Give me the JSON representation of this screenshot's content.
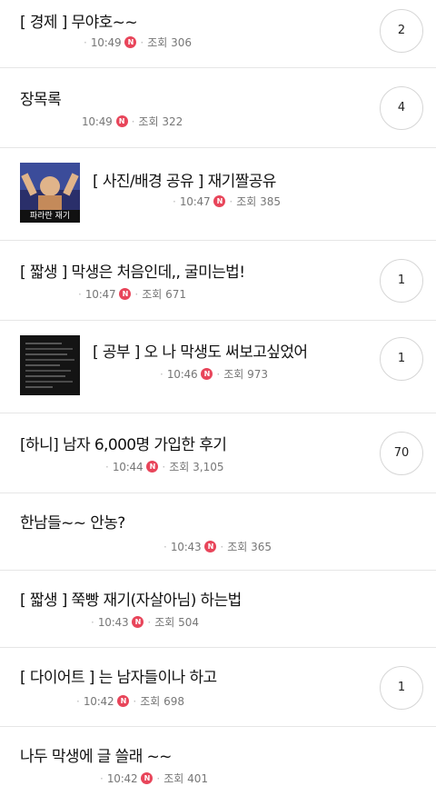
{
  "posts": [
    {
      "title": "[ 경제 ] 무야호~~",
      "time": "10:49",
      "views": "조회 306",
      "comments": "2"
    },
    {
      "title": "장목록",
      "time": "10:49",
      "views": "조회 322",
      "comments": "4"
    },
    {
      "title": "[ 사진/배경 공유 ] 재기짤공유",
      "time": "10:47",
      "views": "조회 385",
      "thumb_caption": "파라란 재기"
    },
    {
      "title": "[ 짧생 ] 막생은 처음인데,, 굴미는법!",
      "time": "10:47",
      "views": "조회 671",
      "comments": "1"
    },
    {
      "title": "[ 공부 ] 오 나 막생도 써보고싶었어",
      "time": "10:46",
      "views": "조회 973",
      "comments": "1"
    },
    {
      "title": "[하니] 남자 6,000명 가입한 후기",
      "time": "10:44",
      "views": "조회 3,105",
      "comments": "70"
    },
    {
      "title": "한남들~~ 안농?",
      "time": "10:43",
      "views": "조회 365"
    },
    {
      "title": "[ 짧생 ] 쭉빵 재기(자살아님) 하는법",
      "time": "10:43",
      "views": "조회 504"
    },
    {
      "title": "[ 다이어트 ] 는 남자들이나 하고",
      "time": "10:42",
      "views": "조회 698",
      "comments": "1"
    },
    {
      "title": "나두 막생에 글 쓸래 ~~",
      "time": "10:42",
      "views": "조회 401"
    }
  ],
  "badge_letter": "N",
  "colors": {
    "badge": "#e8455a",
    "divider": "#e6e6e6",
    "meta": "#777777"
  }
}
